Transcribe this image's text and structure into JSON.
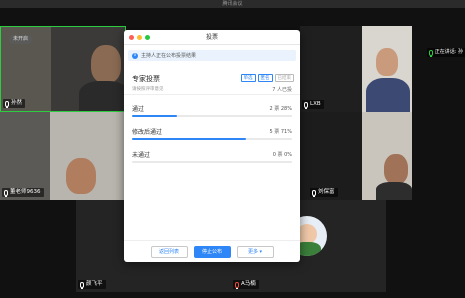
{
  "window": {
    "title": "腾讯会议"
  },
  "tiles": [
    {
      "id": "t1",
      "name": "孙然",
      "badge": "未开启",
      "mic": "on"
    },
    {
      "id": "t2",
      "name": "LXB",
      "mic": "on"
    },
    {
      "id": "t3",
      "name": "",
      "speaking_label": "正在讲话: 孙",
      "mic": "green"
    },
    {
      "id": "t4",
      "name": "董老师9636",
      "mic": "on"
    },
    {
      "id": "t5",
      "name": "刘保富",
      "mic": "on"
    },
    {
      "id": "t6",
      "name": "颜飞平",
      "mic": "on"
    },
    {
      "id": "t7",
      "name": "A马楠",
      "mic": "off"
    }
  ],
  "dialog": {
    "title": "投票",
    "notice": "主持人正在公布投票结果",
    "vote_title": "专家投票",
    "vote_subtitle": "请按照评审意见",
    "tags": [
      "单选",
      "匿名",
      "已结束"
    ],
    "participants": "7 人已投",
    "options": [
      {
        "label": "通过",
        "votes": "2 票",
        "percent": "28%",
        "ratio": 0.28
      },
      {
        "label": "修改后通过",
        "votes": "5 票",
        "percent": "71%",
        "ratio": 0.71
      },
      {
        "label": "未通过",
        "votes": "0 票",
        "percent": "0%",
        "ratio": 0
      }
    ],
    "buttons": {
      "back": "返回列表",
      "stop": "停止公布",
      "more": "更多 ▾"
    }
  },
  "colors": {
    "accent": "#2f86f6",
    "close": "#ff5f57",
    "minimize": "#febc2e",
    "maximize": "#28c840"
  }
}
